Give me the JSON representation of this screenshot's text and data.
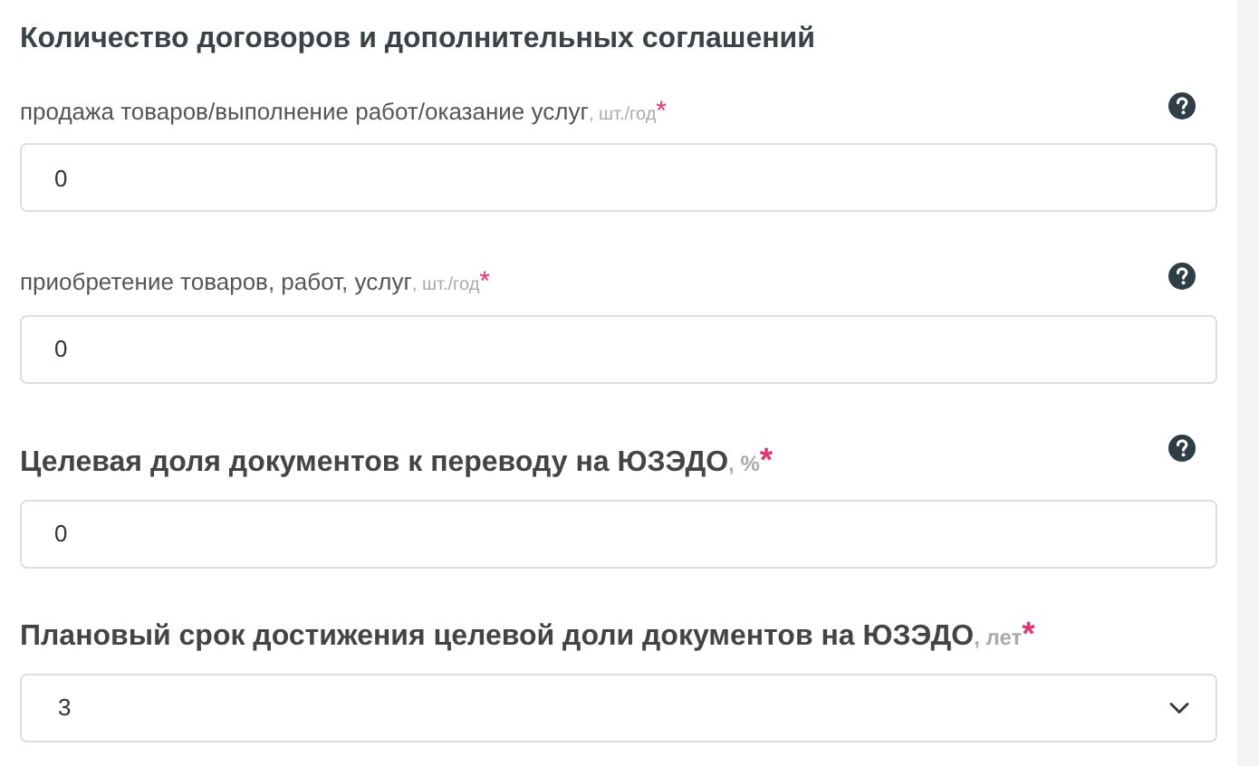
{
  "section_title": "Количество договоров и дополнительных соглашений",
  "fields": [
    {
      "kind": "field",
      "label": "продажа товаров/выполнение работ/оказание услуг",
      "unit": ", шт./год",
      "required_mark": "*",
      "help": true,
      "value": "0"
    },
    {
      "kind": "field",
      "label": "приобретение товаров, работ, услуг",
      "unit": ", шт./год",
      "required_mark": "*",
      "help": true,
      "value": "0"
    },
    {
      "kind": "bigfield",
      "label": "Целевая доля документов к переводу на ЮЗЭДО",
      "unit": ", %",
      "required_mark": "*",
      "help": true,
      "value": "0"
    },
    {
      "kind": "bigselect",
      "label": "Плановый срок достижения целевой доли документов на ЮЗЭДО",
      "unit": ", лет",
      "required_mark": "*",
      "help": false,
      "value": "3"
    }
  ]
}
